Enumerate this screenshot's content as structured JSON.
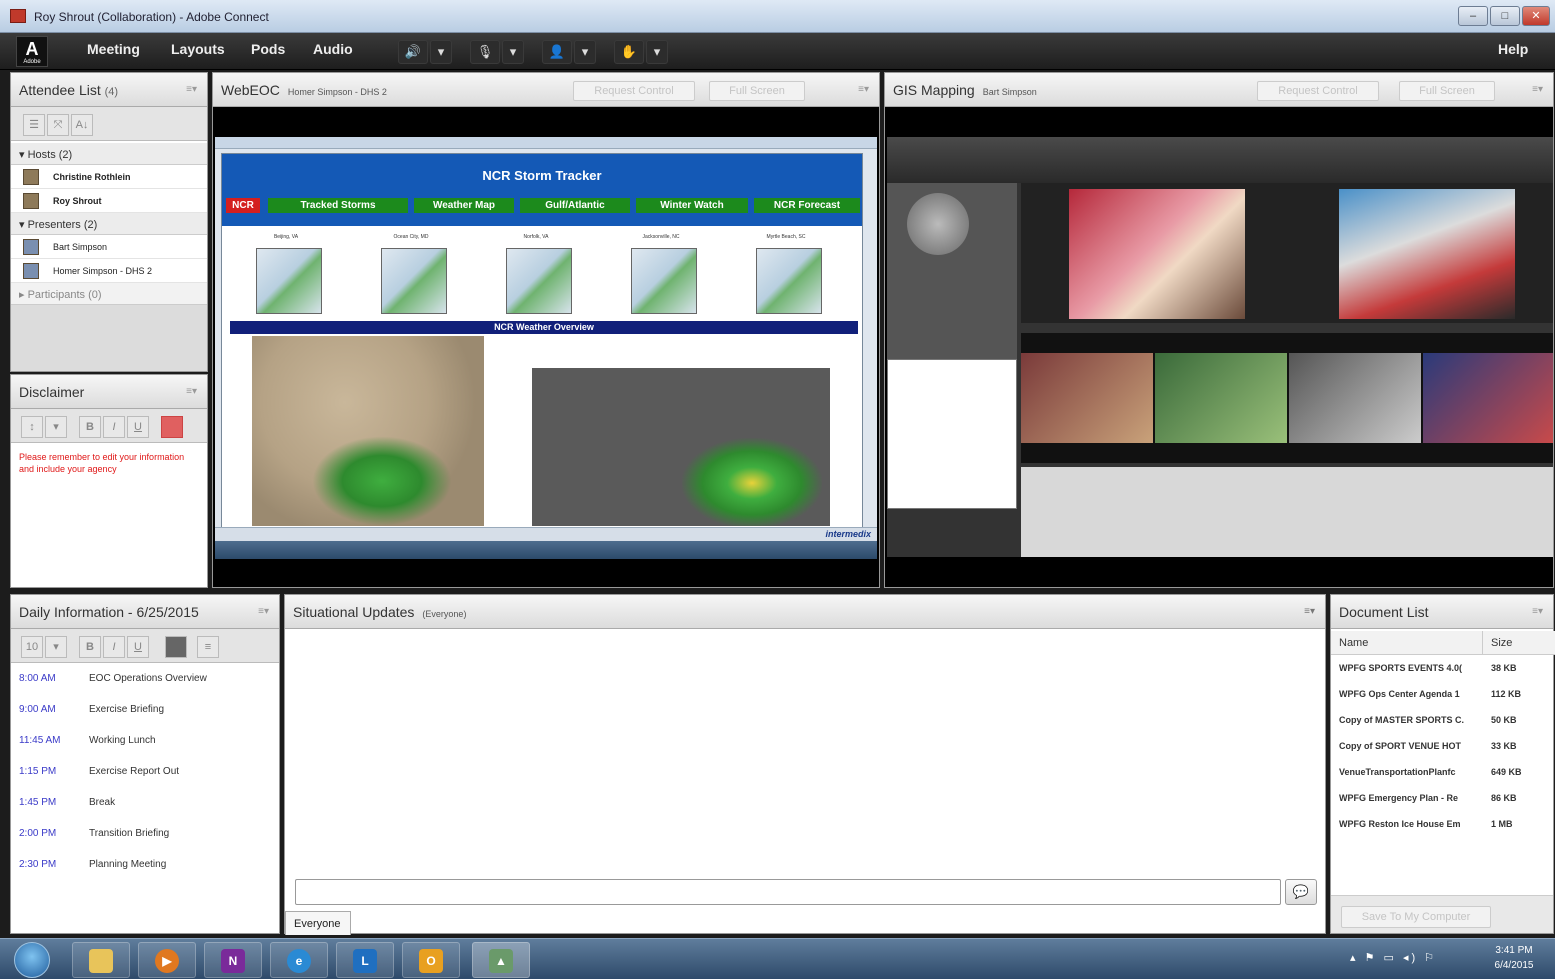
{
  "window": {
    "title": "Roy Shrout (Collaboration) - Adobe Connect",
    "min": "–",
    "max": "□",
    "close": "✕"
  },
  "menubar": {
    "logo": "A",
    "logo_sub": "Adobe",
    "items": [
      "Meeting",
      "Layouts",
      "Pods",
      "Audio"
    ],
    "help": "Help",
    "tools": [
      "🔊",
      "▾",
      "🎙",
      "▾",
      "👤",
      "▾",
      "✋",
      "▾"
    ]
  },
  "attendee": {
    "title": "Attendee List",
    "count": "(4)",
    "hosts_label": "Hosts (2)",
    "hosts": [
      "Christine Rothlein",
      "Roy Shrout"
    ],
    "presenters_label": "Presenters (2)",
    "presenters": [
      "Bart Simpson",
      "Homer Simpson - DHS 2"
    ],
    "participants_label": "Participants (0)"
  },
  "disclaimer": {
    "title": "Disclaimer",
    "text": "Please remember to edit your information and include your agency"
  },
  "webeoc": {
    "title": "WebEOC",
    "subtitle": "Homer Simpson - DHS 2",
    "request": "Request Control",
    "full": "Full Screen",
    "screen": {
      "tracker_title": "NCR Storm Tracker",
      "nav": [
        "NCR",
        "Tracked Storms",
        "Weather Map",
        "Gulf/Atlantic",
        "Winter Watch",
        "NCR Forecast"
      ],
      "cities": [
        "Beijing, VA",
        "Ocean City, MD",
        "Norfolk, VA",
        "Jacksonville, NC",
        "Myrtle Beach, SC"
      ],
      "overview": "NCR Weather Overview",
      "brand": "intermedix"
    }
  },
  "gis": {
    "title": "GIS Mapping",
    "subtitle": "Bart Simpson",
    "request": "Request Control",
    "full": "Full Screen"
  },
  "daily": {
    "title": "Daily Information - 6/25/2015",
    "items": [
      {
        "time": "8:00 AM",
        "event": "EOC Operations Overview"
      },
      {
        "time": "9:00 AM",
        "event": "Exercise Briefing"
      },
      {
        "time": "11:45 AM",
        "event": "Working Lunch"
      },
      {
        "time": "1:15 PM",
        "event": "Exercise Report Out"
      },
      {
        "time": "1:45 PM",
        "event": "Break"
      },
      {
        "time": "2:00 PM",
        "event": "Transition Briefing"
      },
      {
        "time": "2:30 PM",
        "event": "Planning Meeting"
      }
    ]
  },
  "situational": {
    "title": "Situational Updates",
    "scope": "(Everyone)",
    "input_placeholder": "",
    "send": "💬",
    "tab": "Everyone"
  },
  "documents": {
    "title": "Document List",
    "col_name": "Name",
    "col_size": "Size",
    "rows": [
      {
        "name": "WPFG SPORTS EVENTS 4.0(",
        "size": "38 KB"
      },
      {
        "name": "WPFG Ops Center Agenda 1",
        "size": "112 KB"
      },
      {
        "name": "Copy of MASTER SPORTS C.",
        "size": "50 KB"
      },
      {
        "name": "Copy of SPORT VENUE HOT",
        "size": "33 KB"
      },
      {
        "name": "VenueTransportationPlanfc",
        "size": "649 KB"
      },
      {
        "name": "WPFG Emergency Plan - Re",
        "size": "86 KB"
      },
      {
        "name": "WPFG Reston Ice House Em",
        "size": "1 MB"
      }
    ],
    "save": "Save To My Computer"
  },
  "taskbar": {
    "time": "3:41 PM",
    "date": "6/4/2015",
    "tray": "▴ ⚑ ▭ ◂) ⚐"
  }
}
